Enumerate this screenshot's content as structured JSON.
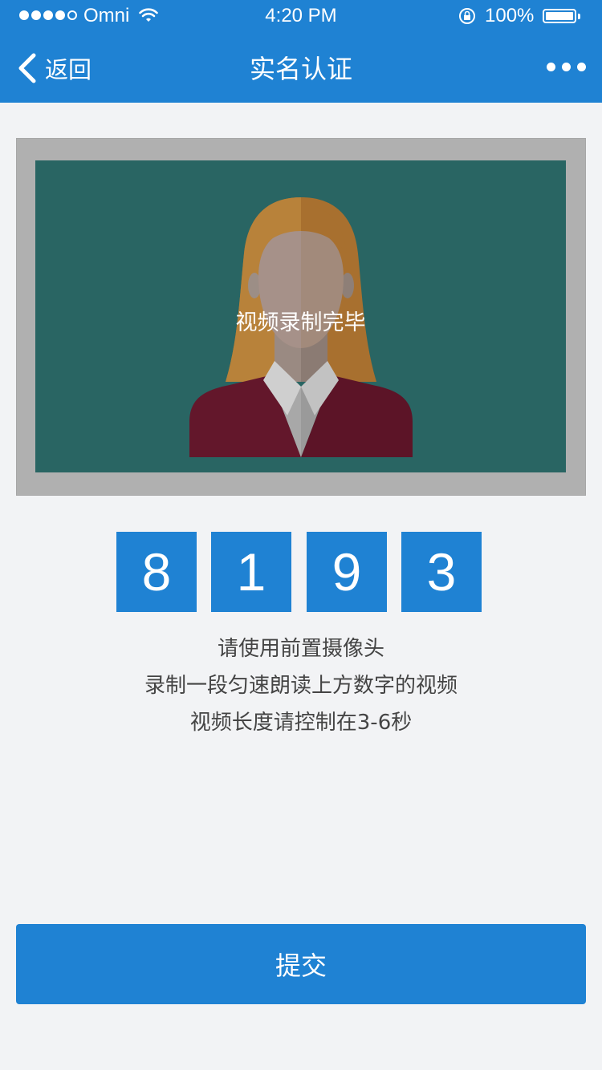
{
  "status_bar": {
    "carrier": "Omni",
    "time": "4:20 PM",
    "battery": "100%",
    "signal_bars_filled": 4,
    "signal_bars_total": 5
  },
  "nav": {
    "back_label": "返回",
    "title": "实名认证"
  },
  "video": {
    "status_text": "视频录制完毕"
  },
  "digits": [
    "8",
    "1",
    "9",
    "3"
  ],
  "instructions": [
    "请使用前置摄像头",
    "录制一段匀速朗读上方数字的视频",
    "视频长度请控制在3-6秒"
  ],
  "submit_label": "提交",
  "colors": {
    "primary": "#1f82d3",
    "background": "#f2f3f5",
    "video_bg": "#296563",
    "frame": "#b0b0b0"
  }
}
